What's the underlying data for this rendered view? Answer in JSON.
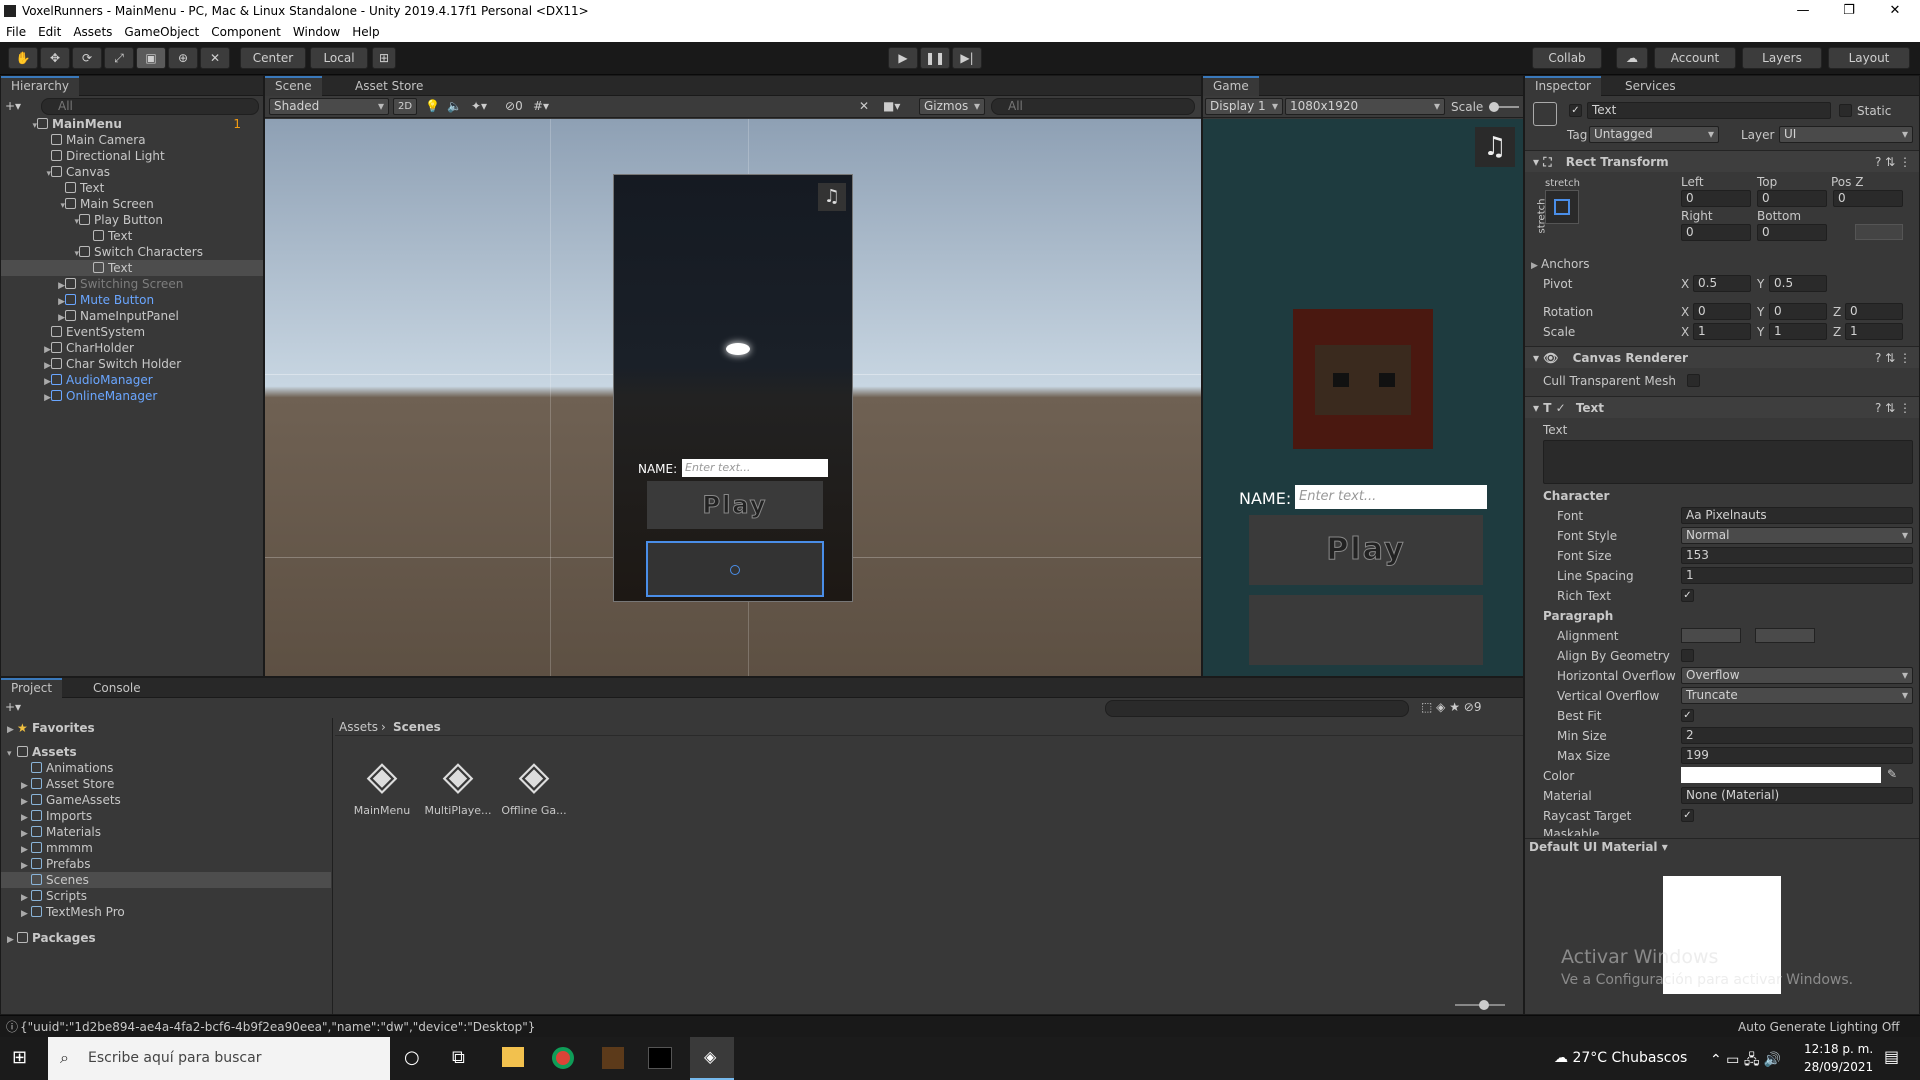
{
  "window": {
    "title": "VoxelRunners - MainMenu - PC, Mac & Linux Standalone - Unity 2019.4.17f1 Personal <DX11>",
    "minimize": "—",
    "maximize": "❐",
    "close": "✕"
  },
  "menu": [
    "File",
    "Edit",
    "Assets",
    "GameObject",
    "Component",
    "Window",
    "Help"
  ],
  "toolbar": {
    "center": "Center",
    "local": "Local",
    "collab": "Collab",
    "account": "Account",
    "layers": "Layers",
    "layout": "Layout"
  },
  "hierarchy": {
    "tab": "Hierarchy",
    "search_placeholder": "All",
    "badge": "1",
    "items": [
      {
        "label": "MainMenu",
        "depth": 0,
        "expanded": true
      },
      {
        "label": "Main Camera",
        "depth": 1
      },
      {
        "label": "Directional Light",
        "depth": 1
      },
      {
        "label": "Canvas",
        "depth": 1,
        "expanded": true
      },
      {
        "label": "Text",
        "depth": 2
      },
      {
        "label": "Main Screen",
        "depth": 2,
        "expanded": true
      },
      {
        "label": "Play Button",
        "depth": 3,
        "expanded": true
      },
      {
        "label": "Text",
        "depth": 4
      },
      {
        "label": "Switch Characters",
        "depth": 3,
        "expanded": true
      },
      {
        "label": "Text",
        "depth": 4,
        "selected": true
      },
      {
        "label": "Switching Screen",
        "depth": 2,
        "collapsed": true,
        "dim": true
      },
      {
        "label": "Mute Button",
        "depth": 2,
        "collapsed": true,
        "blue": true
      },
      {
        "label": "NameInputPanel",
        "depth": 2,
        "collapsed": true
      },
      {
        "label": "EventSystem",
        "depth": 1
      },
      {
        "label": "CharHolder",
        "depth": 1,
        "collapsed": true
      },
      {
        "label": "Char Switch Holder",
        "depth": 1,
        "collapsed": true
      },
      {
        "label": "AudioManager",
        "depth": 1,
        "collapsed": true,
        "blue": true
      },
      {
        "label": "OnlineManager",
        "depth": 1,
        "collapsed": true,
        "blue": true
      }
    ]
  },
  "scene": {
    "tab": "Scene",
    "tab2": "Asset Store",
    "shading": "Shaded",
    "mode2d": "2D",
    "hidden_count": "0",
    "gizmos": "Gizmos",
    "search_placeholder": "All",
    "name_label": "NAME:",
    "input_placeholder": "Enter text...",
    "play_label": "Play"
  },
  "game": {
    "tab": "Game",
    "display": "Display 1",
    "resolution": "1080x1920",
    "scale": "Scale",
    "name_label": "NAME:",
    "input_placeholder": "Enter text...",
    "play_label": "Play"
  },
  "inspector": {
    "tab": "Inspector",
    "tab2": "Services",
    "object_name": "Text",
    "static_label": "Static",
    "tag_label": "Tag",
    "tag": "Untagged",
    "layer_label": "Layer",
    "layer": "UI",
    "rect": {
      "title": "Rect Transform",
      "stretch_top": "stretch",
      "stretch_side": "stretch",
      "left_label": "Left",
      "left": "0",
      "top_label": "Top",
      "top": "0",
      "posz_label": "Pos Z",
      "posz": "0",
      "right_label": "Right",
      "right": "0",
      "bottom_label": "Bottom",
      "bottom": "0",
      "anchors": "Anchors",
      "pivot": "Pivot",
      "pivot_x": "0.5",
      "pivot_y": "0.5",
      "rotation": "Rotation",
      "rot_x": "0",
      "rot_y": "0",
      "rot_z": "0",
      "scale": "Scale",
      "scale_x": "1",
      "scale_y": "1",
      "scale_z": "1"
    },
    "canvas_renderer": {
      "title": "Canvas Renderer",
      "cull": "Cull Transparent Mesh"
    },
    "text": {
      "title": "Text",
      "text_label": "Text",
      "text_value": "",
      "character": "Character",
      "font_label": "Font",
      "font": "Pixelnauts",
      "font_style_label": "Font Style",
      "font_style": "Normal",
      "font_size_label": "Font Size",
      "font_size": "153",
      "line_spacing_label": "Line Spacing",
      "line_spacing": "1",
      "rich_text_label": "Rich Text",
      "paragraph": "Paragraph",
      "alignment_label": "Alignment",
      "align_geom_label": "Align By Geometry",
      "h_overflow_label": "Horizontal Overflow",
      "h_overflow": "Overflow",
      "v_overflow_label": "Vertical Overflow",
      "v_overflow": "Truncate",
      "best_fit_label": "Best Fit",
      "min_size_label": "Min Size",
      "min_size": "2",
      "max_size_label": "Max Size",
      "max_size": "199",
      "color_label": "Color",
      "material_label": "Material",
      "material": "None (Material)",
      "raycast_label": "Raycast Target",
      "maskable_label": "Maskable"
    },
    "default_material": "Default UI Material",
    "watermark_title": "Activar Windows",
    "watermark_sub": "Ve a Configuración para activar Windows."
  },
  "project": {
    "tab": "Project",
    "tab2": "Console",
    "hidden_count": "9",
    "favorites": "Favorites",
    "assets": "Assets",
    "folders": [
      "Animations",
      "Asset Store",
      "GameAssets",
      "Imports",
      "Materials",
      "mmmm",
      "Prefabs",
      "Scenes",
      "Scripts",
      "TextMesh Pro"
    ],
    "selected_folder": "Scenes",
    "packages": "Packages",
    "breadcrumb": [
      "Assets",
      "Scenes"
    ],
    "files": [
      "MainMenu",
      "MultiPlaye...",
      "Offline Ga..."
    ]
  },
  "status": {
    "message": "{\"uuid\":\"1d2be894-ae4a-4fa2-bcf6-4b9f2ea90eea\",\"name\":\"dw\",\"device\":\"Desktop\"}",
    "right": "Auto Generate Lighting Off"
  },
  "taskbar": {
    "search_placeholder": "Escribe aquí para buscar",
    "weather": "27°C  Chubascos",
    "time": "12:18 p. m.",
    "date": "28/09/2021"
  },
  "colors": {
    "accent": "#3a79bb",
    "prefab_blue": "#6aa6ff",
    "sky": "#c8d6e2",
    "ground": "#6b5b48",
    "game_bg": "#1e3b3f"
  }
}
